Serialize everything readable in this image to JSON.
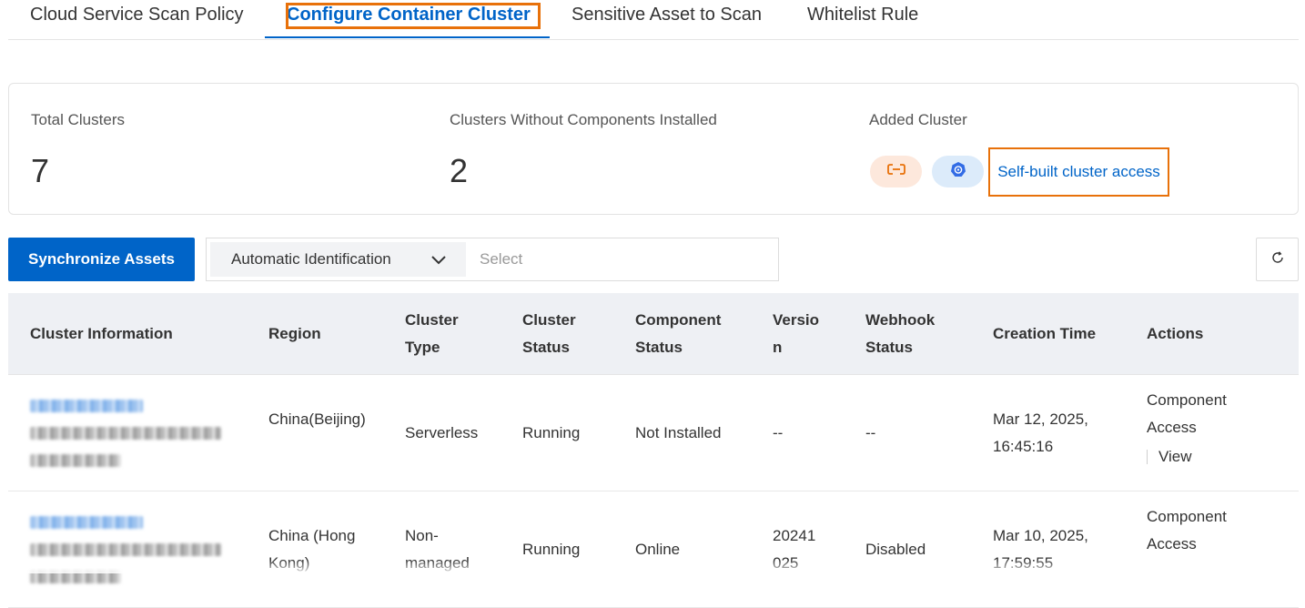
{
  "tabs": [
    {
      "label": "Cloud Service Scan Policy",
      "active": false
    },
    {
      "label": "Configure Container Cluster",
      "active": true
    },
    {
      "label": "Sensitive Asset to Scan",
      "active": false
    },
    {
      "label": "Whitelist Rule",
      "active": false
    }
  ],
  "stats": {
    "total_label": "Total Clusters",
    "total_value": "7",
    "without_label": "Clusters Without Components Installed",
    "without_value": "2",
    "added_label": "Added Cluster",
    "added_icons": [
      "link-icon",
      "kubernetes-icon"
    ],
    "self_built_link": "Self-built cluster access"
  },
  "toolbar": {
    "sync_label": "Synchronize Assets",
    "filter_mode": "Automatic Identification",
    "filter_placeholder": "Select",
    "refresh_icon": "refresh-icon"
  },
  "table": {
    "headers": [
      "Cluster Information",
      "Region",
      "Cluster Type",
      "Cluster Status",
      "Component Status",
      "Version",
      "Webhook Status",
      "Creation Time",
      "Actions"
    ],
    "rows": [
      {
        "region": "China(Beijing)",
        "type": "Serverless",
        "status": "Running",
        "component_status": "Not Installed",
        "version": "--",
        "webhook": "--",
        "created": "Mar 12, 2025, 16:45:16",
        "action_primary": "Component Access",
        "action_secondary": "View"
      },
      {
        "region": "China (Hong Kong)",
        "type": "Non-managed",
        "status": "Running",
        "component_status": "Online",
        "version": "20241025",
        "webhook": "Disabled",
        "created": "Mar 10, 2025, 17:59:55",
        "action_primary": "Component Access"
      }
    ]
  },
  "colors": {
    "accent": "#0064c8",
    "highlight": "#e8710a",
    "header_bg": "#eef0f4"
  }
}
